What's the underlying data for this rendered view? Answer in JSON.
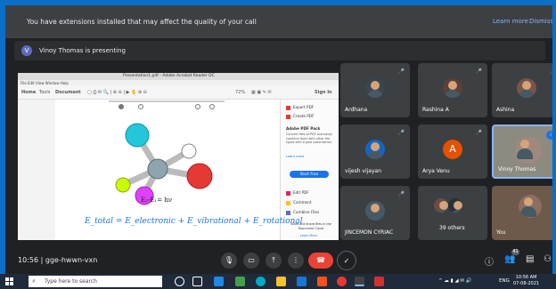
{
  "banner": {
    "message": "You have extensions installed that may affect the quality of your call",
    "learn_more": "Learn more",
    "dismiss": "Dismiss"
  },
  "presenting": {
    "avatar_letter": "V",
    "text": "Vinoy Thomas is presenting"
  },
  "shared_screen": {
    "window_title": "Presentation1.pdf - Adobe Acrobat Reader DC",
    "menu": "File  Edit  View  Window  Help",
    "tabs": [
      "Home",
      "Tools",
      "Document"
    ],
    "zoom": "72%",
    "sign_in": "Sign In",
    "right_pane": {
      "export": "Export PDF",
      "create": "Create PDF",
      "promo_title": "Adobe PDF Pack",
      "promo_text": "Convert files to PDF and easily combine them with other file types with a paid subscription.",
      "promo_link": "Learn more",
      "start_trial": "Start Free",
      "edit": "Edit PDF",
      "comment": "Comment",
      "combine": "Combine Files",
      "store_title": "Store and share files in the Document Cloud",
      "store_link": "Learn More"
    },
    "equation_energy": "E₂-E₁= hν",
    "equation_total": "E_total = E_electronic + E_vibrational + E_rotational"
  },
  "tiles": [
    {
      "name": "Ardhana",
      "kind": "photo"
    },
    {
      "name": "Rashina A",
      "kind": "photo"
    },
    {
      "name": "Ashina",
      "kind": "photo"
    },
    {
      "name": "vijesh vijayan",
      "kind": "photo"
    },
    {
      "name": "Arya Venu",
      "kind": "letter",
      "letter": "A"
    },
    {
      "name": "Vinoy Thomas",
      "kind": "photo",
      "active": true
    },
    {
      "name": "JINCEMON CYRIAC",
      "kind": "photo"
    },
    {
      "name": "39 others",
      "kind": "group"
    },
    {
      "name": "You",
      "kind": "photo"
    }
  ],
  "bottom": {
    "time": "10:56",
    "separator": "|",
    "meeting_code": "gge-hwwn-vxn",
    "participants_count": "41"
  },
  "taskbar": {
    "search_placeholder": "Type here to search",
    "language": "ENG",
    "time": "10:56 AM",
    "date": "07-08-2021"
  },
  "colors": {
    "accent": "#8ab4f8",
    "end_call": "#ea4335",
    "desktop": "#0b6fc7"
  }
}
